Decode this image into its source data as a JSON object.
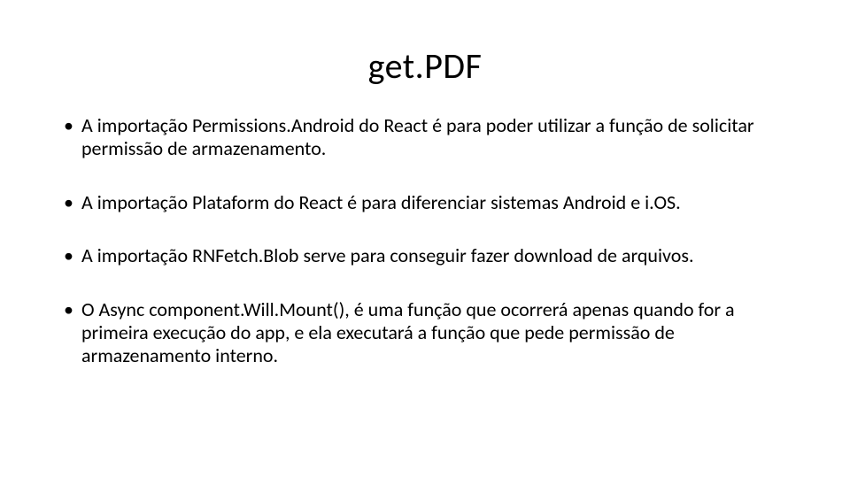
{
  "title": "get.PDF",
  "bullets": [
    "A importação Permissions.Android do React é para poder utilizar a função de solicitar permissão de armazenamento.",
    "A importação Plataform do React é para diferenciar sistemas Android e i.OS.",
    "A importação RNFetch.Blob serve para conseguir fazer download de arquivos.",
    "O Async component.Will.Mount(), é uma função que ocorrerá apenas quando for a primeira execução do app, e ela executará a função que pede permissão de armazenamento interno."
  ]
}
